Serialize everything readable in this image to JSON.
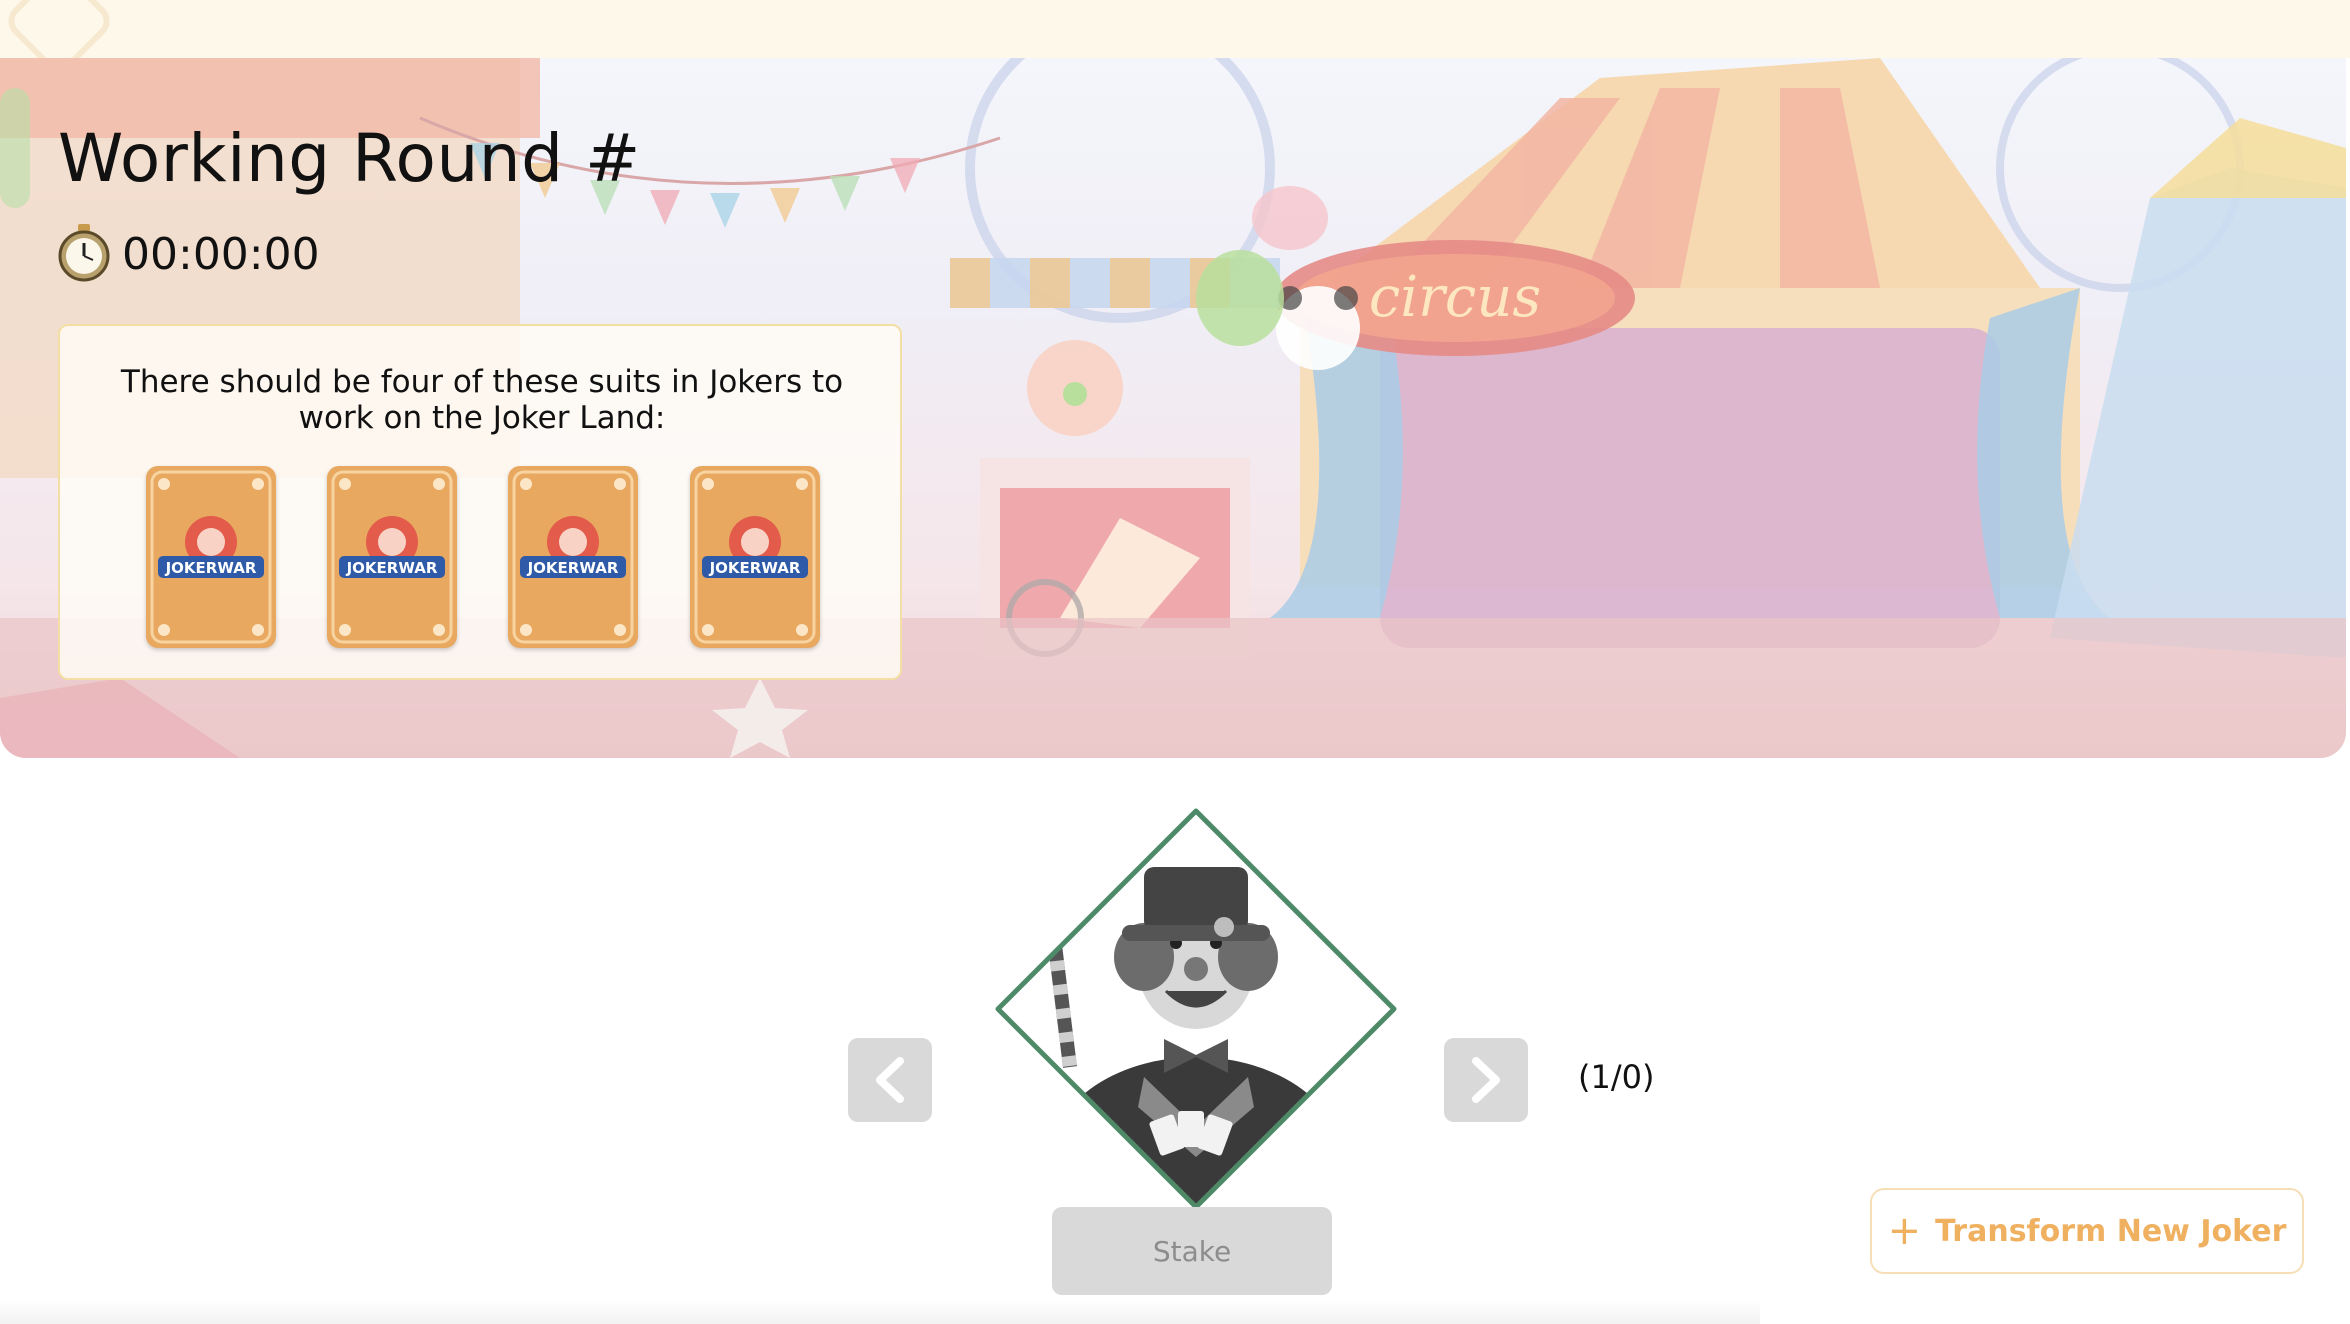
{
  "header": {
    "title": "Working Round #",
    "timer": "00:00:00",
    "timer_icon": "stopwatch-icon"
  },
  "info": {
    "text": "There should be four of these suits in Jokers to work on the Joker Land:",
    "card_logo": "JOKERWAR",
    "card_count": 4
  },
  "banner": {
    "sign_text": "circus"
  },
  "carousel": {
    "counter": "(1/0)",
    "prev_icon": "chevron-left-icon",
    "next_icon": "chevron-right-icon"
  },
  "actions": {
    "stake_label": "Stake",
    "transform_label": "Transform New Joker",
    "transform_icon": "plus-icon"
  },
  "colors": {
    "accent": "#efb060",
    "diamond_border": "#4f8a68",
    "card": "#e9a85f"
  }
}
